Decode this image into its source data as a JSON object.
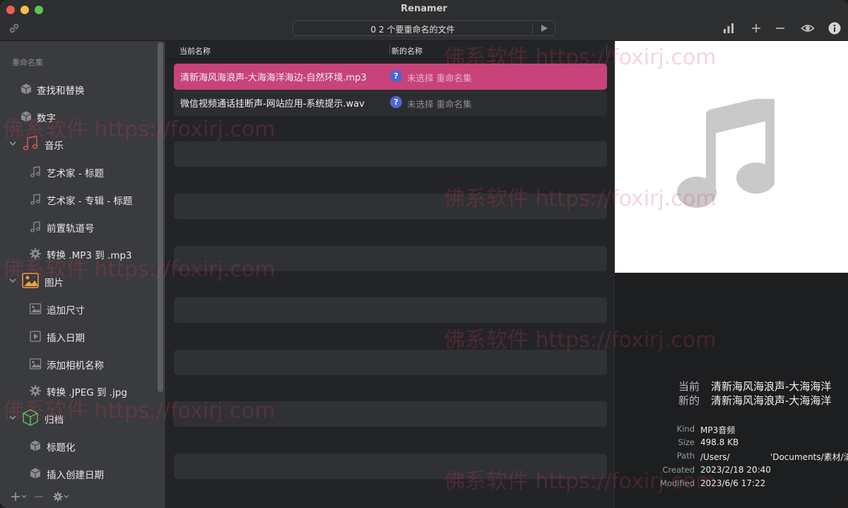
{
  "window": {
    "title": "Renamer"
  },
  "toolbar": {
    "file_count_label": "0 2 个要重命名的文件"
  },
  "sidebar": {
    "header": "重命名集",
    "items": [
      {
        "label": "查找和替换",
        "icon": "cube-icon"
      },
      {
        "label": "数字",
        "icon": "cube-icon"
      },
      {
        "label": "音乐",
        "icon": "music-note-icon",
        "group": true
      },
      {
        "label": "艺术家 - 标题",
        "icon": "music-note-icon"
      },
      {
        "label": "艺术家 - 专辑 - 标题",
        "icon": "music-note-icon"
      },
      {
        "label": "前置轨道号",
        "icon": "music-note-icon"
      },
      {
        "label": "转换 .MP3 到 .mp3",
        "icon": "gear-icon"
      },
      {
        "label": "图片",
        "icon": "picture-icon",
        "group": true
      },
      {
        "label": "追加尺寸",
        "icon": "picture-icon"
      },
      {
        "label": "插入日期",
        "icon": "film-icon"
      },
      {
        "label": "添加相机名称",
        "icon": "picture-icon"
      },
      {
        "label": "转换 .JPEG 到 .jpg",
        "icon": "gear-icon"
      },
      {
        "label": "归档",
        "icon": "archive-box-icon",
        "group": true
      },
      {
        "label": "标题化",
        "icon": "cube-icon"
      },
      {
        "label": "插入创建日期",
        "icon": "cube-icon"
      }
    ]
  },
  "file_list": {
    "columns": {
      "current": "当前名称",
      "new": "新的名称"
    },
    "rows": [
      {
        "current": "清新海风海浪声-大海海洋海边-自然环境.mp3",
        "status_badge": "?",
        "status": "未选择 重命名集",
        "selected": true
      },
      {
        "current": "微信视频通话挂断声-网站应用-系统提示.wav",
        "status_badge": "?",
        "status": "未选择 重命名集",
        "selected": false
      }
    ]
  },
  "preview": {
    "current_label": "当前",
    "current_value": "清新海风海浪声-大海海洋",
    "new_label": "新的",
    "new_value": "清新海风海浪声-大海海洋",
    "meta": [
      {
        "key": "Kind",
        "value": "MP3音频"
      },
      {
        "key": "Size",
        "value": "498.8 KB"
      },
      {
        "key": "Path",
        "value": "/Users/               'Documents/素材/清新"
      },
      {
        "key": "Created",
        "value": "2023/2/18 20:40"
      },
      {
        "key": "Modified",
        "value": "2023/6/6 17:22"
      }
    ]
  },
  "watermark": "佛系软件 https://foxirj.com",
  "colors": {
    "selection": "#c7437a",
    "badge": "#4d66d6",
    "music_group": "#e0535c",
    "image_group": "#f0a23a",
    "archive_group": "#5cc85a"
  }
}
